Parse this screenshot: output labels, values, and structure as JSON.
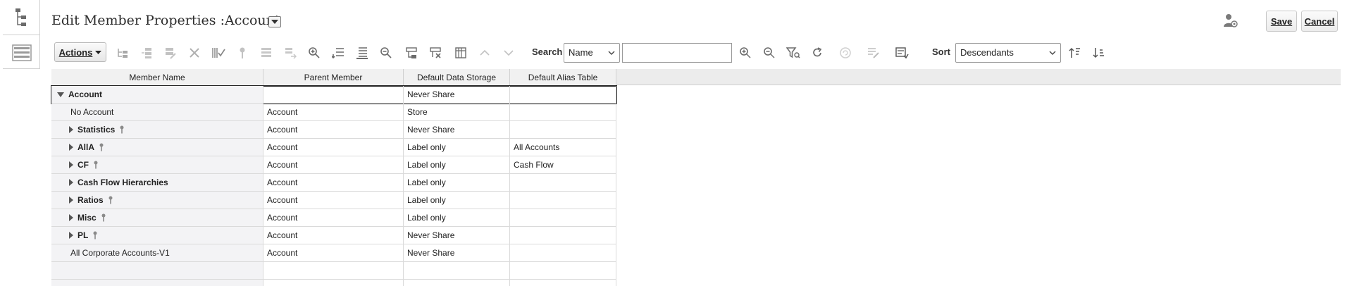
{
  "rail": {
    "items": [
      {
        "name": "hierarchy-view",
        "icon": "tree-icon"
      },
      {
        "name": "list-view",
        "icon": "list-icon"
      }
    ]
  },
  "header": {
    "title": "Edit Member Properties :Account",
    "save_label": "Save",
    "cancel_label": "Cancel"
  },
  "toolbar": {
    "actions_label": "Actions",
    "search_label": "Search",
    "search_field_value": "Name",
    "search_value": "",
    "sort_label": "Sort",
    "sort_value": "Descendants"
  },
  "grid": {
    "columns": [
      "Member Name",
      "Parent Member",
      "Default Data Storage",
      "Default Alias Table"
    ],
    "rows": [
      {
        "name": "Account",
        "parent": "",
        "storage": "Never Share",
        "alias": "",
        "expander": "down",
        "bold": true,
        "key": false,
        "selected": true
      },
      {
        "name": "No Account",
        "parent": "Account",
        "storage": "Store",
        "alias": "",
        "expander": "none",
        "bold": false,
        "key": false,
        "selected": false
      },
      {
        "name": "Statistics",
        "parent": "Account",
        "storage": "Never Share",
        "alias": "",
        "expander": "right",
        "bold": true,
        "key": true,
        "selected": false
      },
      {
        "name": "AllA",
        "parent": "Account",
        "storage": "Label only",
        "alias": "All Accounts",
        "expander": "right",
        "bold": true,
        "key": true,
        "selected": false
      },
      {
        "name": "CF",
        "parent": "Account",
        "storage": "Label only",
        "alias": "Cash Flow",
        "expander": "right",
        "bold": true,
        "key": true,
        "selected": false
      },
      {
        "name": "Cash Flow Hierarchies",
        "parent": "Account",
        "storage": "Label only",
        "alias": "",
        "expander": "right",
        "bold": true,
        "key": false,
        "selected": false
      },
      {
        "name": "Ratios",
        "parent": "Account",
        "storage": "Label only",
        "alias": "",
        "expander": "right",
        "bold": true,
        "key": true,
        "selected": false
      },
      {
        "name": "Misc",
        "parent": "Account",
        "storage": "Label only",
        "alias": "",
        "expander": "right",
        "bold": true,
        "key": true,
        "selected": false
      },
      {
        "name": "PL",
        "parent": "Account",
        "storage": "Never Share",
        "alias": "",
        "expander": "right",
        "bold": true,
        "key": true,
        "selected": false
      },
      {
        "name": "All Corporate Accounts-V1",
        "parent": "Account",
        "storage": "Never Share",
        "alias": "",
        "expander": "none",
        "bold": false,
        "key": false,
        "selected": false
      },
      {
        "name": "",
        "parent": "",
        "storage": "",
        "alias": "",
        "expander": "none",
        "bold": false,
        "key": false,
        "selected": false
      },
      {
        "name": "",
        "parent": "",
        "storage": "",
        "alias": "",
        "expander": "none",
        "bold": false,
        "key": false,
        "selected": false
      }
    ]
  },
  "colors": {
    "header_bg": "#ececec",
    "name_col_bg": "#f3f3f5",
    "icon_gray": "#8a8a8a"
  }
}
